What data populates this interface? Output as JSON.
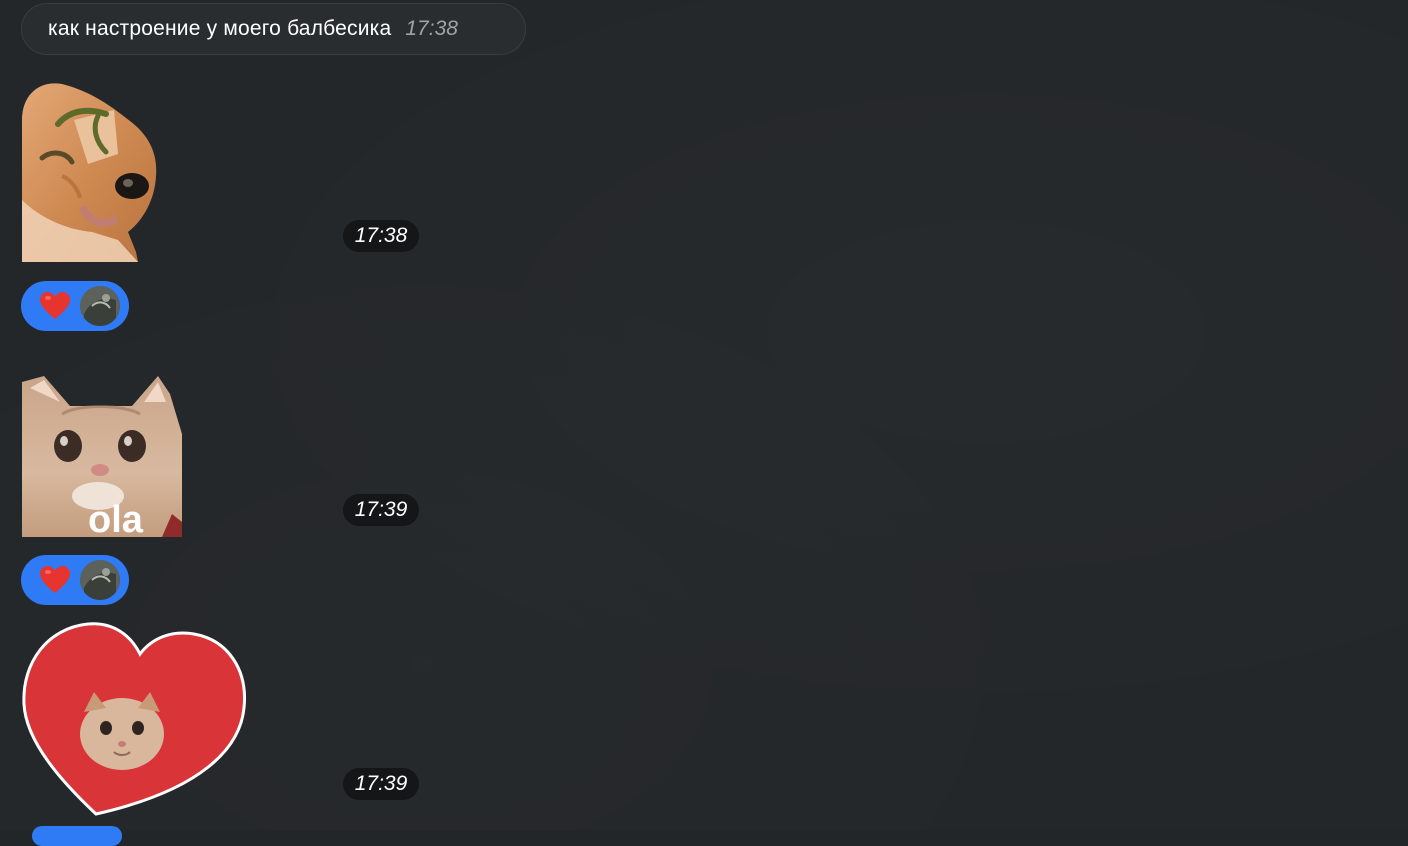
{
  "messages": [
    {
      "type": "text",
      "text": "как настроение у моего балбесика",
      "time": "17:38"
    },
    {
      "type": "sticker",
      "sticker": "cat-with-eyebrows-sticker",
      "time": "17:38",
      "reaction": {
        "emoji": "❤️",
        "avatar": "avatar-photo"
      }
    },
    {
      "type": "sticker",
      "sticker": "cat-ola-sticker",
      "caption": "ola",
      "time": "17:39",
      "reaction": {
        "emoji": "❤️",
        "avatar": "avatar-photo"
      }
    },
    {
      "type": "sticker",
      "sticker": "heart-cat-sticker",
      "time": "17:39"
    }
  ],
  "colors": {
    "background": "#24272a",
    "reaction": "#2f7bf6",
    "heart": "#d93437",
    "bubble": "#2a2d30"
  }
}
